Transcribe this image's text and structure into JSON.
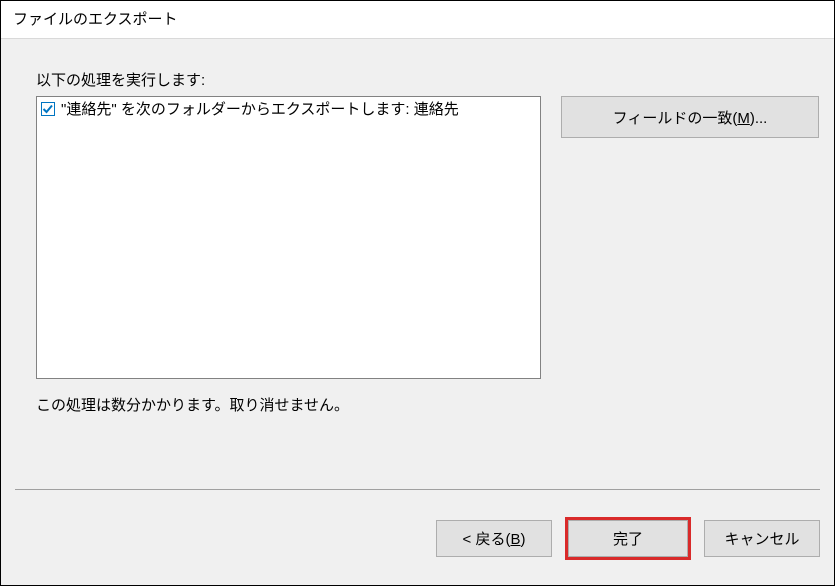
{
  "title": "ファイルのエクスポート",
  "instructions": "以下の処理を実行します:",
  "item": {
    "checked": true,
    "text": "\"連絡先\" を次のフォルダーからエクスポートします: 連絡先"
  },
  "mapFields": {
    "prefix": "フィールドの一致(",
    "accel": "M",
    "suffix": ")..."
  },
  "note": "この処理は数分かかります。取り消せません。",
  "buttons": {
    "back": {
      "prefix": "< 戻る(",
      "accel": "B",
      "suffix": ")"
    },
    "finish": "完了",
    "cancel": "キャンセル"
  }
}
